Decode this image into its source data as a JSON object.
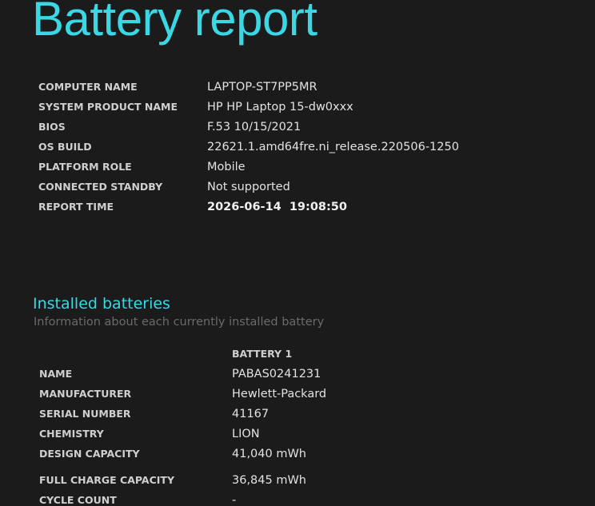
{
  "title": "Battery report",
  "system_info": [
    {
      "label": "COMPUTER NAME",
      "value": "LAPTOP-ST7PP5MR"
    },
    {
      "label": "SYSTEM PRODUCT NAME",
      "value": "HP HP Laptop 15-dw0xxx"
    },
    {
      "label": "BIOS",
      "value": "F.53 10/15/2021"
    },
    {
      "label": "OS BUILD",
      "value": "22621.1.amd64fre.ni_release.220506-1250"
    },
    {
      "label": "PLATFORM ROLE",
      "value": "Mobile"
    },
    {
      "label": "CONNECTED STANDBY",
      "value": "Not supported"
    },
    {
      "label": "REPORT TIME",
      "value": "2026-06-14  19:08:50"
    }
  ],
  "installed_batteries": {
    "title": "Installed batteries",
    "subtitle": "Information about each currently installed battery",
    "column_header": "BATTERY 1",
    "rows": [
      {
        "label": "NAME",
        "value": "PABAS0241231"
      },
      {
        "label": "MANUFACTURER",
        "value": "Hewlett-Packard"
      },
      {
        "label": "SERIAL NUMBER",
        "value": "41167"
      },
      {
        "label": "CHEMISTRY",
        "value": "LION"
      },
      {
        "label": "DESIGN CAPACITY",
        "value": "41,040 mWh"
      },
      {
        "label": "FULL CHARGE CAPACITY",
        "value": "36,845 mWh"
      },
      {
        "label": "CYCLE COUNT",
        "value": "-"
      }
    ]
  },
  "colors": {
    "background": "#1b1b1b",
    "accent": "#3ad8e4",
    "subtitle": "#6a6a6a",
    "text": "#e2e2e2"
  }
}
